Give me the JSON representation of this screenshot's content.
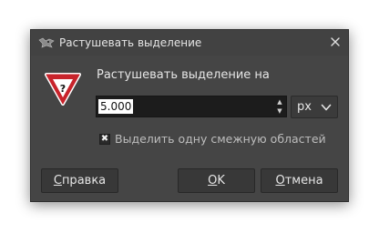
{
  "window": {
    "title": "Растушевать выделение",
    "icon": "gimp-wilber-icon",
    "close_icon": "close-icon"
  },
  "dialog": {
    "warning_icon": "question-warning-icon",
    "prompt": "Растушевать выделение на",
    "amount": {
      "value": "5.000",
      "up_icon": "spin-up-icon",
      "down_icon": "spin-down-icon"
    },
    "unit": {
      "selected": "px",
      "chevron_icon": "chevron-down-icon"
    },
    "checkbox": {
      "checked": true,
      "mark": "✖",
      "label": "Выделить одну смежную областей"
    }
  },
  "buttons": {
    "help": "Справка",
    "ok": "OK",
    "cancel": "Отмена"
  },
  "colors": {
    "dialog_bg": "#454545",
    "titlebar_bg": "#424242",
    "button_bg": "#383838",
    "warning_red": "#c8232b",
    "text": "#e6e6e6"
  }
}
